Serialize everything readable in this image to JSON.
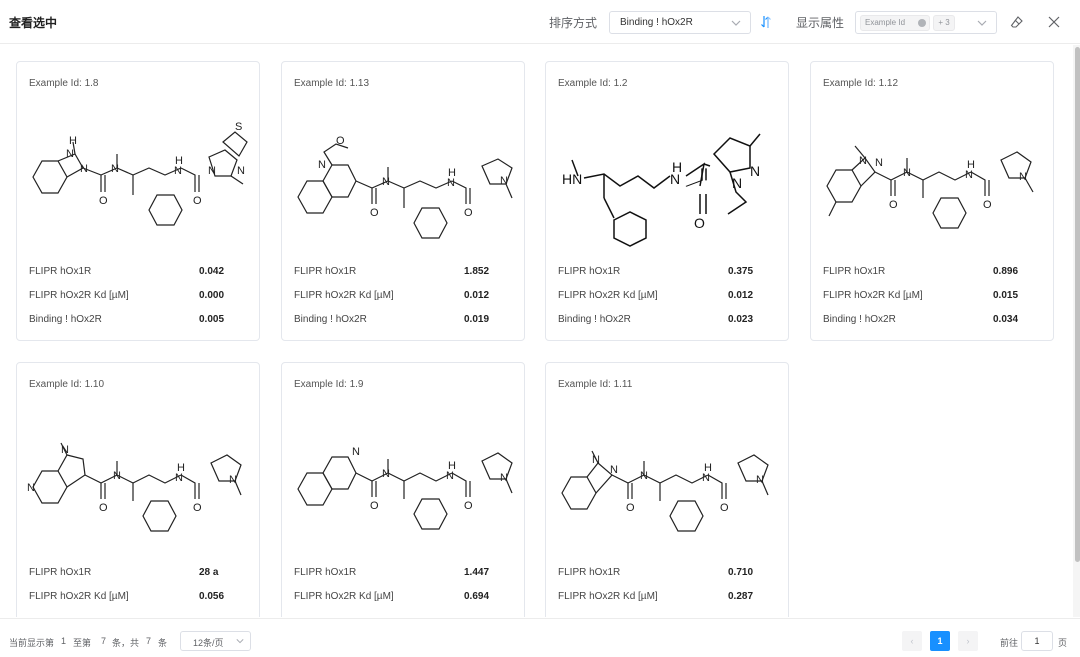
{
  "header": {
    "title": "查看选中",
    "sort_label": "排序方式",
    "sort_value": "Binding ! hOx2R",
    "attr_label": "显示属性",
    "attr_tag": "Example Id",
    "attr_more": "+ 3"
  },
  "cards": [
    {
      "title": "Example Id: 1.8",
      "props": [
        {
          "name": "FLIPR hOx1R",
          "value": "0.042"
        },
        {
          "name": "FLIPR hOx2R Kd [µM]",
          "value": "0.000"
        },
        {
          "name": "Binding ! hOx2R",
          "value": "0.005"
        }
      ]
    },
    {
      "title": "Example Id: 1.13",
      "props": [
        {
          "name": "FLIPR hOx1R",
          "value": "1.852"
        },
        {
          "name": "FLIPR hOx2R Kd [µM]",
          "value": "0.012"
        },
        {
          "name": "Binding ! hOx2R",
          "value": "0.019"
        }
      ]
    },
    {
      "title": "Example Id: 1.2",
      "props": [
        {
          "name": "FLIPR hOx1R",
          "value": "0.375"
        },
        {
          "name": "FLIPR hOx2R Kd [µM]",
          "value": "0.012"
        },
        {
          "name": "Binding ! hOx2R",
          "value": "0.023"
        }
      ]
    },
    {
      "title": "Example Id: 1.12",
      "props": [
        {
          "name": "FLIPR hOx1R",
          "value": "0.896"
        },
        {
          "name": "FLIPR hOx2R Kd [µM]",
          "value": "0.015"
        },
        {
          "name": "Binding ! hOx2R",
          "value": "0.034"
        }
      ]
    },
    {
      "title": "Example Id: 1.10",
      "props": [
        {
          "name": "FLIPR hOx1R",
          "value": "28 a"
        },
        {
          "name": "FLIPR hOx2R Kd [µM]",
          "value": "0.056"
        }
      ]
    },
    {
      "title": "Example Id: 1.9",
      "props": [
        {
          "name": "FLIPR hOx1R",
          "value": "1.447"
        },
        {
          "name": "FLIPR hOx2R Kd [µM]",
          "value": "0.694"
        }
      ]
    },
    {
      "title": "Example Id: 1.11",
      "props": [
        {
          "name": "FLIPR hOx1R",
          "value": "0.710"
        },
        {
          "name": "FLIPR hOx2R Kd [µM]",
          "value": "0.287"
        }
      ]
    }
  ],
  "footer": {
    "t1": "当前显示第",
    "from": "1",
    "t2": "至第",
    "to": "7",
    "t3": "条，共",
    "total": "7",
    "t4": "条",
    "page_size": "12条/页",
    "prev": "‹",
    "current_page": "1",
    "next": "›",
    "goto": "前往",
    "goto_value": "1",
    "page_unit": "页"
  }
}
